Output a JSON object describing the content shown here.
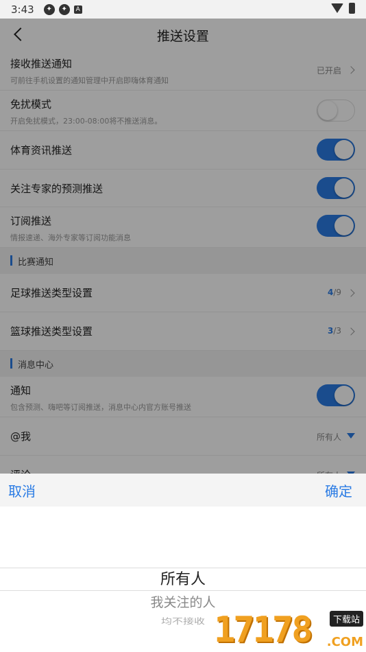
{
  "status": {
    "time": "3:43"
  },
  "header": {
    "title": "推送设置"
  },
  "rows": {
    "receive": {
      "label": "接收推送通知",
      "sub": "可前往手机设置的通知管理中开启即嗨体育通知",
      "value": "已开启"
    },
    "dnd": {
      "label": "免扰模式",
      "sub": "开启免扰模式，23:00-08:00将不推送消息。",
      "on": false
    },
    "sports_news": {
      "label": "体育资讯推送",
      "on": true
    },
    "expert_predict": {
      "label": "关注专家的预测推送",
      "on": true
    },
    "subscribe": {
      "label": "订阅推送",
      "sub": "情报速递、海外专家等订阅功能消息",
      "on": true
    }
  },
  "section_match": {
    "title": "比赛通知"
  },
  "match": {
    "football": {
      "label": "足球推送类型设置",
      "selected": "4",
      "total": "/9"
    },
    "basketball": {
      "label": "篮球推送类型设置",
      "selected": "3",
      "total": "/3"
    }
  },
  "section_msg": {
    "title": "消息中心"
  },
  "msg": {
    "notify": {
      "label": "通知",
      "sub": "包含预测、嗨吧等订阅推送，消息中心内官方账号推送",
      "on": true
    },
    "at_me": {
      "label": "@我",
      "value": "所有人"
    },
    "comment": {
      "label": "评论",
      "value": "所有人"
    }
  },
  "picker": {
    "cancel": "取消",
    "confirm": "确定",
    "options": [
      "所有人",
      "我关注的人",
      "均不接收"
    ]
  },
  "watermark": {
    "digits": "17178",
    "tag": "下载站",
    "com": ".COM"
  },
  "colors": {
    "accent": "#2a7be4"
  }
}
